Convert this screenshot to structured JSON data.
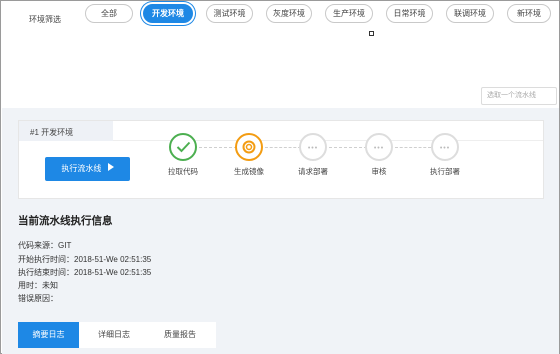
{
  "filter": {
    "label": "环境筛选",
    "tabs": [
      {
        "label": "全部",
        "active": false
      },
      {
        "label": "开发环境",
        "active": true
      },
      {
        "label": "测试环境",
        "active": false
      },
      {
        "label": "灰度环境",
        "active": false
      },
      {
        "label": "生产环境",
        "active": false
      },
      {
        "label": "日常环境",
        "active": false
      },
      {
        "label": "联调环境",
        "active": false
      },
      {
        "label": "新环境",
        "active": false
      }
    ],
    "pipeline_select_placeholder": "选取一个流水线"
  },
  "pipeline": {
    "title": "#1 开发环境",
    "run_button_label": "执行流水线",
    "stages": [
      {
        "label": "拉取代码",
        "status": "done"
      },
      {
        "label": "生成镜像",
        "status": "running"
      },
      {
        "label": "请求部署",
        "status": "pending"
      },
      {
        "label": "审核",
        "status": "pending"
      },
      {
        "label": "执行部署",
        "status": "pending"
      }
    ]
  },
  "info": {
    "title": "当前流水线执行信息",
    "lines": [
      "代码来源：GIT",
      "开始执行时间：2018-51-We 02:51:35",
      "执行结束时间：2018-51-We 02:51:35",
      "用时：未知",
      "错误原因："
    ]
  },
  "log_tabs": [
    {
      "label": "摘要日志",
      "active": true
    },
    {
      "label": "详细日志",
      "active": false
    },
    {
      "label": "质量报告",
      "active": false
    }
  ],
  "colors": {
    "primary": "#1e88e5",
    "done": "#4caf50",
    "running": "#f39c12",
    "pending": "#dddddd",
    "background": "#f0f3f7"
  }
}
